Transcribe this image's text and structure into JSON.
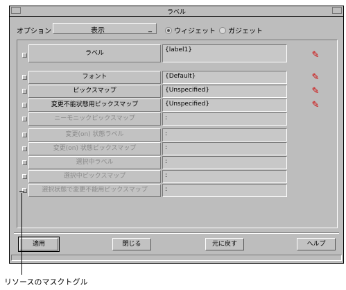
{
  "window": {
    "title": "ラベル"
  },
  "option": {
    "label": "オプション",
    "selected": "表示",
    "caret": "_",
    "radio_widget": "ウィジェット",
    "radio_gadget": "ガジェット",
    "selected_radio": "widget"
  },
  "resources": [
    {
      "label": "ラベル",
      "value": "{label1}",
      "active": true,
      "editable": true
    },
    {
      "label": "フォント",
      "value": "{Default}",
      "active": true,
      "editable": true
    },
    {
      "label": "ピックスマップ",
      "value": "{Unspecified}",
      "active": true,
      "editable": true
    },
    {
      "label": "変更不能状態用ピックスマップ",
      "value": "{Unspecified}",
      "active": true,
      "editable": true
    },
    {
      "label": "ニーモニックピックスマップ",
      "value": ":",
      "active": false,
      "editable": false
    },
    {
      "label": "変更(on) 状態ラベル",
      "value": ":",
      "active": false,
      "editable": false
    },
    {
      "label": "変更(on) 状態ピックスマップ",
      "value": ":",
      "active": false,
      "editable": false
    },
    {
      "label": "選択中ラベル",
      "value": ":",
      "active": false,
      "editable": false
    },
    {
      "label": "選択中ピックスマップ",
      "value": ":",
      "active": false,
      "editable": false
    },
    {
      "label": "選択状態で変更不能用ピックスマップ",
      "value": ":",
      "active": false,
      "editable": false
    }
  ],
  "icons": {
    "edit": "edit-icon"
  },
  "buttons": {
    "apply": "適用",
    "close": "閉じる",
    "reset": "元に戻す",
    "help": "ヘルプ"
  },
  "callout": "リソースのマスクトグル",
  "colors": {
    "window_bg": "#bdbdbd",
    "edit_icon": "#d00000"
  }
}
